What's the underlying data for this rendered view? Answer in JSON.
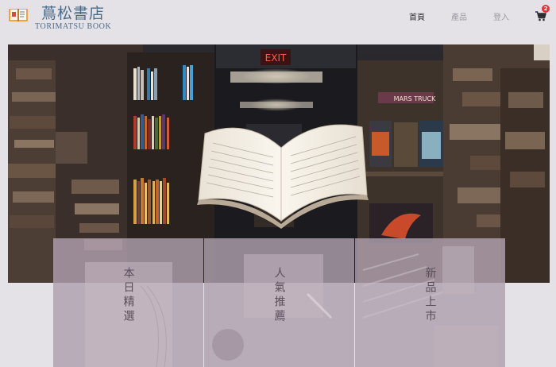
{
  "brand": {
    "name": "蔦松書店",
    "subtitle": "TORIMATSU BOOK"
  },
  "nav": {
    "items": [
      {
        "label": "首頁",
        "active": true
      },
      {
        "label": "產品",
        "active": false
      },
      {
        "label": "登入",
        "active": false
      }
    ],
    "cart_count": "2"
  },
  "hero": {
    "sign_text": "EXIT",
    "shelf_sign": "MARS TRUCK"
  },
  "categories": [
    {
      "label": "本日精選"
    },
    {
      "label": "人氣推薦"
    },
    {
      "label": "新品上市"
    }
  ],
  "colors": {
    "brand_blue": "#4a6c8c",
    "badge_red": "#e3323a",
    "card_overlay": "#b0a0ae"
  }
}
